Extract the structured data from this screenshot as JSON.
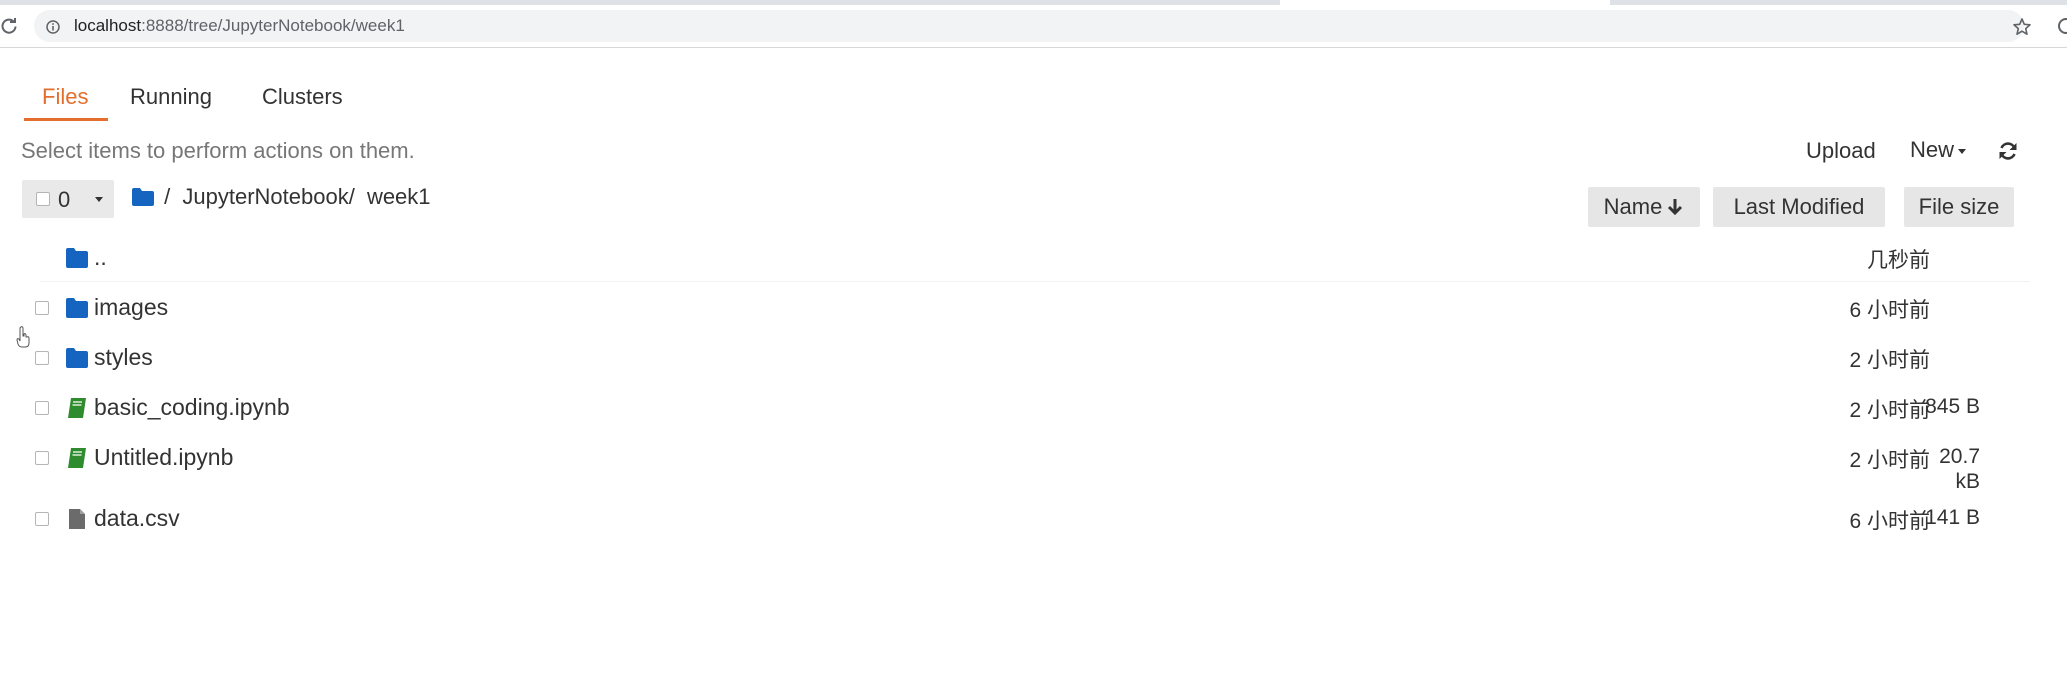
{
  "browser": {
    "url_host": "localhost",
    "url_path": ":8888/tree/JupyterNotebook/week1"
  },
  "tabs": [
    {
      "label": "Files"
    },
    {
      "label": "Running"
    },
    {
      "label": "Clusters"
    }
  ],
  "toolbar": {
    "hint": "Select items to perform actions on them.",
    "upload_label": "Upload",
    "new_label": "New",
    "selected_count": "0"
  },
  "breadcrumb": {
    "root_sep": "/",
    "parts": [
      "JupyterNotebook/",
      "week1"
    ]
  },
  "columns": {
    "name": "Name",
    "last_modified": "Last Modified",
    "file_size": "File size"
  },
  "files": [
    {
      "name": "..",
      "type": "folder",
      "modified": "几秒前",
      "size": ""
    },
    {
      "name": "images",
      "type": "folder",
      "modified": "6 小时前",
      "size": ""
    },
    {
      "name": "styles",
      "type": "folder",
      "modified": "2 小时前",
      "size": ""
    },
    {
      "name": "basic_coding.ipynb",
      "type": "notebook",
      "modified": "2 小时前",
      "size": "845 B"
    },
    {
      "name": "Untitled.ipynb",
      "type": "notebook",
      "modified": "2 小时前",
      "size": "20.7 kB"
    },
    {
      "name": "data.csv",
      "type": "file",
      "modified": "6 小时前",
      "size": "141 B"
    }
  ],
  "colors": {
    "accent": "#e46e2e",
    "folder": "#1565c0",
    "notebook": "#2e8b2e"
  }
}
